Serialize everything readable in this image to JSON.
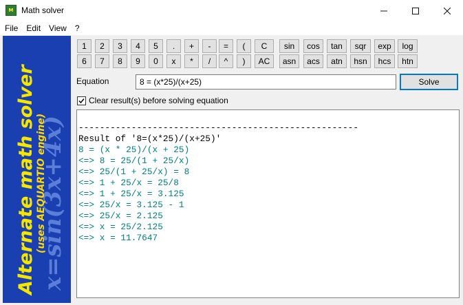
{
  "window": {
    "title": "Math solver",
    "icon": "app-icon"
  },
  "menu": [
    "File",
    "Edit",
    "View",
    "?"
  ],
  "banner": {
    "main_text": "Alternate math solver",
    "sub_text": "(uses AEQUARTIO engine)",
    "formula_text": "x=sin(3x+4x)",
    "colors": {
      "background": "#1a3fb0",
      "main": "#f5e600",
      "sub": "#ffd800",
      "formula": "#5b7fd8"
    }
  },
  "keypad": {
    "row1": [
      "1",
      "2",
      "3",
      "4",
      "5",
      ".",
      "+",
      "-",
      "=",
      "(",
      "C",
      "sin",
      "cos",
      "tan",
      "sqr",
      "exp",
      "log"
    ],
    "row2": [
      "6",
      "7",
      "8",
      "9",
      "0",
      "x",
      "*",
      "/",
      "^",
      ")",
      "AC",
      "asn",
      "acs",
      "atn",
      "hsn",
      "hcs",
      "htn"
    ]
  },
  "equation": {
    "label": "Equation",
    "value": "8 = (x*25)/(x+25)",
    "solve_label": "Solve"
  },
  "options": {
    "clear_results_label": "Clear result(s) before solving equation",
    "clear_results_checked": true
  },
  "results": {
    "lines": [
      {
        "text": "-----------------------------------------------------",
        "color": "#000000"
      },
      {
        "text": "Result of '8=(x*25)/(x+25)'",
        "color": "#000000"
      },
      {
        "text": "8 = (x * 25)/(x + 25)",
        "color": "#008080"
      },
      {
        "text": "<=> 8 = 25/(1 + 25/x)",
        "color": "#008080"
      },
      {
        "text": "<=> 25/(1 + 25/x) = 8",
        "color": "#008080"
      },
      {
        "text": "<=> 1 + 25/x = 25/8",
        "color": "#008080"
      },
      {
        "text": "<=> 1 + 25/x = 3.125",
        "color": "#008080"
      },
      {
        "text": "<=> 25/x = 3.125 - 1",
        "color": "#008080"
      },
      {
        "text": "<=> 25/x = 2.125",
        "color": "#008080"
      },
      {
        "text": "<=> x = 25/2.125",
        "color": "#008080"
      },
      {
        "text": "<=> x = 11.7647",
        "color": "#008080"
      }
    ]
  }
}
